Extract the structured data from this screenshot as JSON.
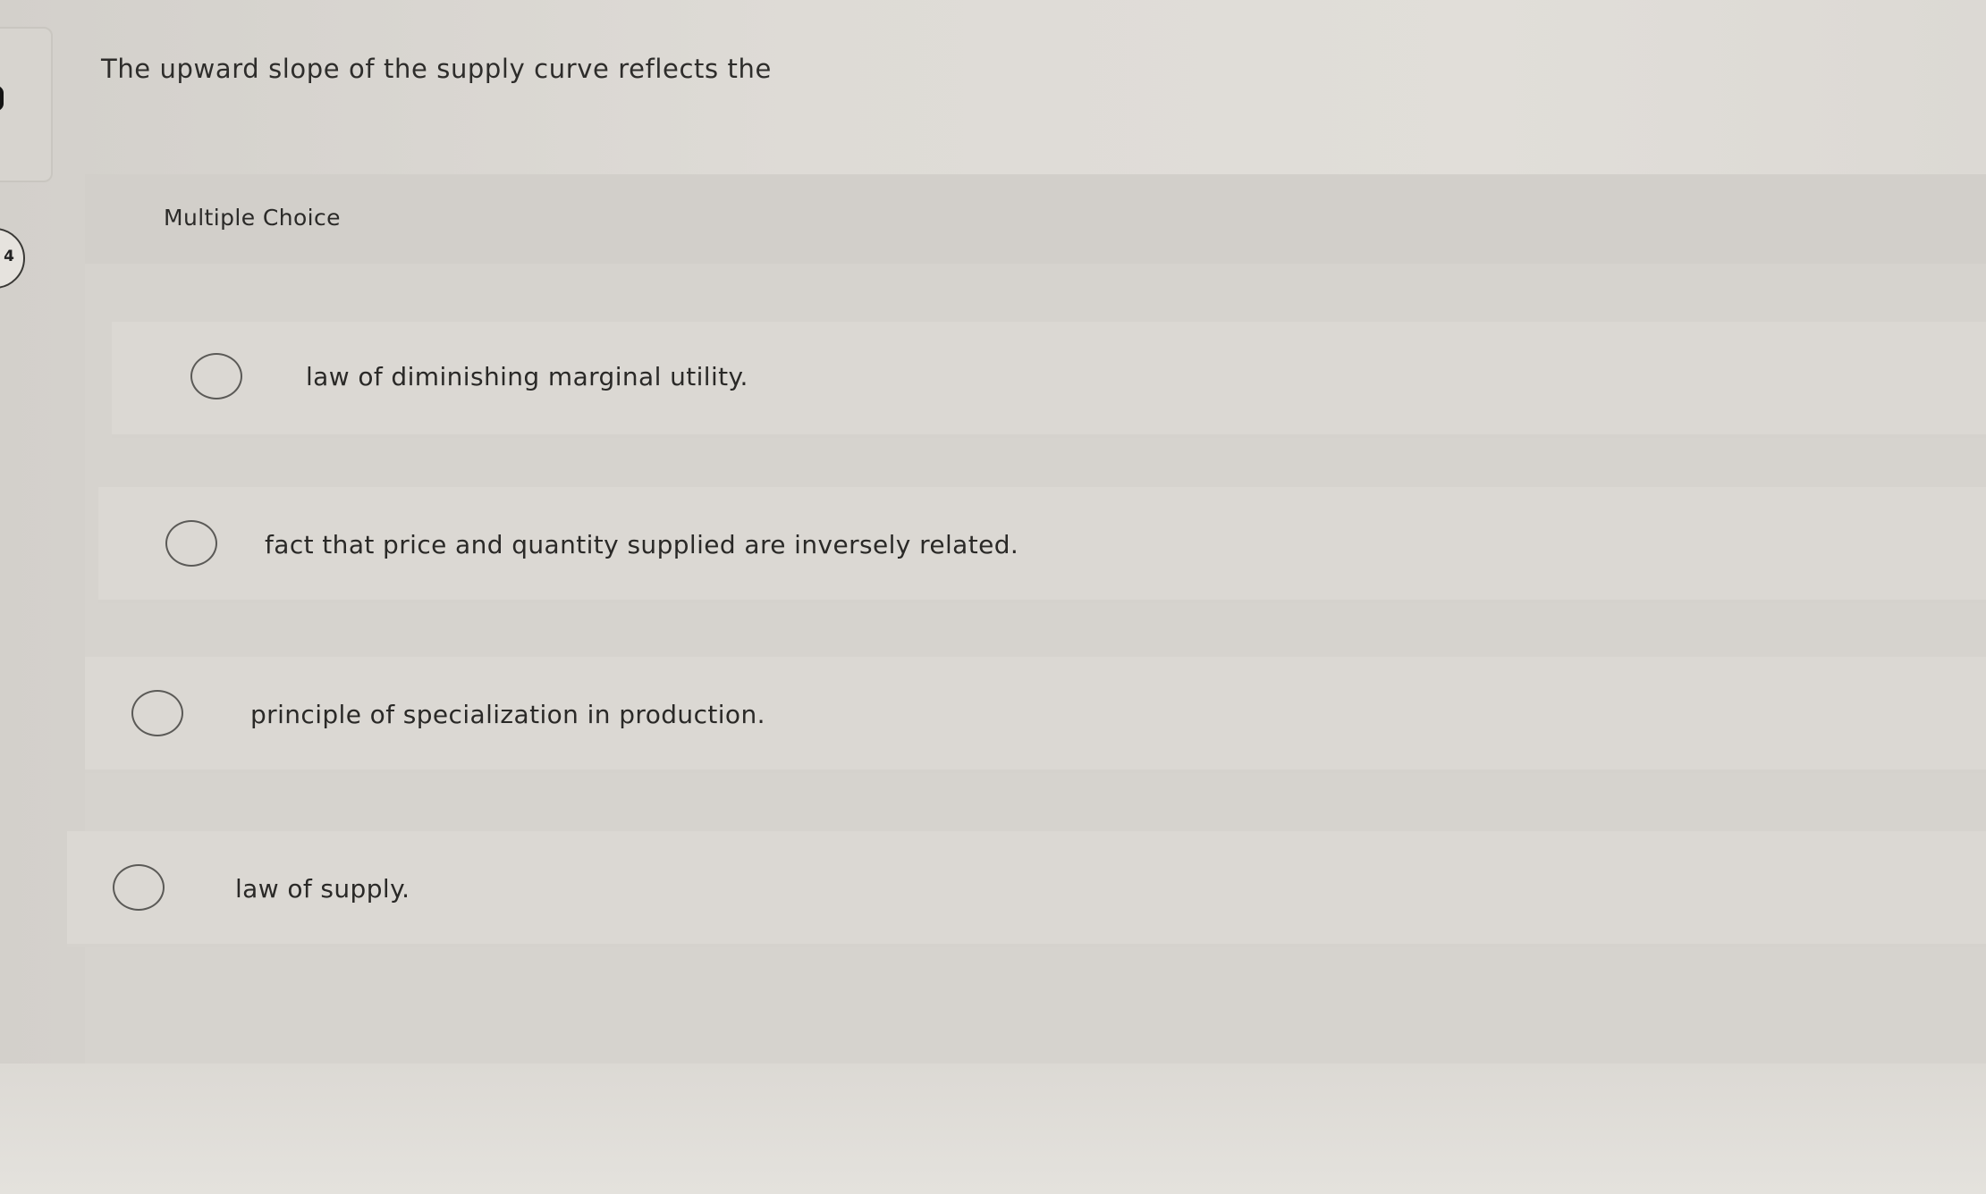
{
  "question": {
    "prompt": "The upward slope of the supply curve reflects the",
    "number": "4"
  },
  "multiple_choice": {
    "label": "Multiple Choice",
    "options": [
      {
        "label": "law of diminishing marginal utility.",
        "selected": false
      },
      {
        "label": "fact that price and quantity supplied are inversely related.",
        "selected": false
      },
      {
        "label": "principle of specialization in production.",
        "selected": false
      },
      {
        "label": "law of supply.",
        "selected": false
      }
    ]
  }
}
